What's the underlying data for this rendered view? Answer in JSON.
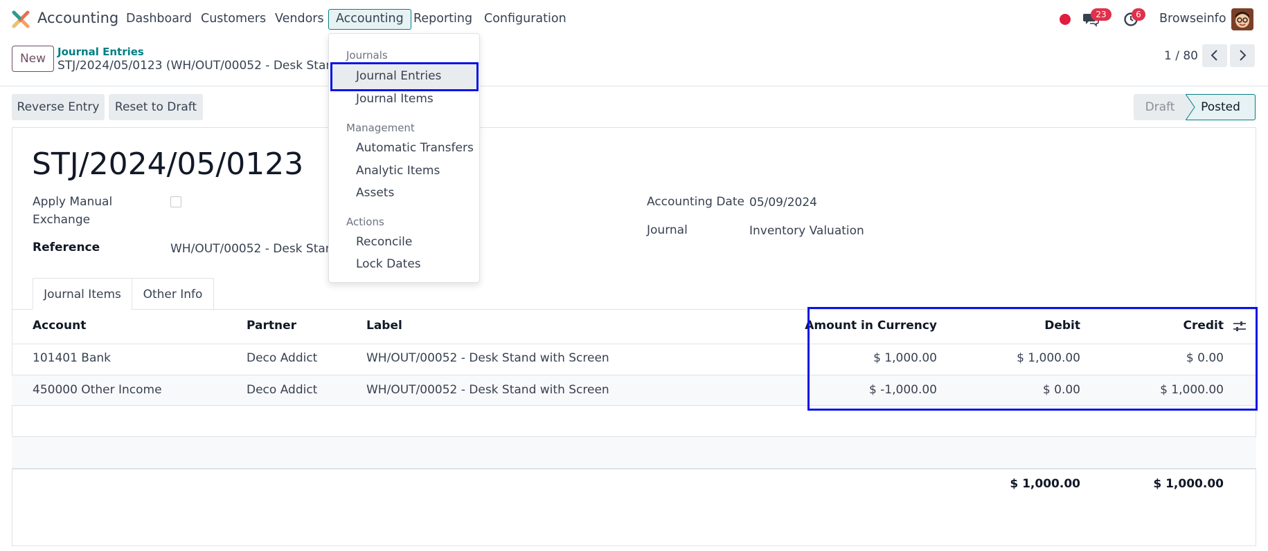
{
  "navbar": {
    "app_name": "Accounting",
    "menu": [
      "Dashboard",
      "Customers",
      "Vendors",
      "Accounting",
      "Reporting",
      "Configuration"
    ],
    "chat_count": "23",
    "activity_count": "6",
    "company": "Browseinfo"
  },
  "control_panel": {
    "new_label": "New",
    "breadcrumb_parent": "Journal Entries",
    "breadcrumb_current": "STJ/2024/05/0123 (WH/OUT/00052 - Desk Stand wi...",
    "pager": "1 / 80"
  },
  "actions": {
    "reverse": "Reverse Entry",
    "reset": "Reset to Draft"
  },
  "status": {
    "draft": "Draft",
    "posted": "Posted"
  },
  "form": {
    "title": "STJ/2024/05/0123",
    "apply_manual_label_1": "Apply Manual",
    "apply_manual_label_2": "Exchange",
    "reference_label": "Reference",
    "reference_value": "WH/OUT/00052 - Desk Stand w",
    "accounting_date_label": "Accounting Date",
    "accounting_date_value": "05/09/2024",
    "journal_label": "Journal",
    "journal_value": "Inventory Valuation"
  },
  "tabs": [
    "Journal Items",
    "Other Info"
  ],
  "table": {
    "headers": {
      "account": "Account",
      "partner": "Partner",
      "label": "Label",
      "amount_currency": "Amount in Currency",
      "debit": "Debit",
      "credit": "Credit"
    },
    "rows": [
      {
        "account": "101401 Bank",
        "partner": "Deco Addict",
        "label": "WH/OUT/00052 - Desk Stand with Screen",
        "amount_currency": "$ 1,000.00",
        "debit": "$ 1,000.00",
        "credit": "$ 0.00"
      },
      {
        "account": "450000 Other Income",
        "partner": "Deco Addict",
        "label": "WH/OUT/00052 - Desk Stand with Screen",
        "amount_currency": "$ -1,000.00",
        "debit": "$ 0.00",
        "credit": "$ 1,000.00"
      }
    ],
    "total_debit": "$ 1,000.00",
    "total_credit": "$ 1,000.00"
  },
  "dropdown": {
    "section_journals": "Journals",
    "journal_entries": "Journal Entries",
    "journal_items": "Journal Items",
    "section_management": "Management",
    "automatic_transfers": "Automatic Transfers",
    "analytic_items": "Analytic Items",
    "assets": "Assets",
    "section_actions": "Actions",
    "reconcile": "Reconcile",
    "lock_dates": "Lock Dates"
  },
  "colors": {
    "brand": "#714b67",
    "teal": "#017e84",
    "annotation": "#0a14e6",
    "badge": "#e1304a"
  }
}
